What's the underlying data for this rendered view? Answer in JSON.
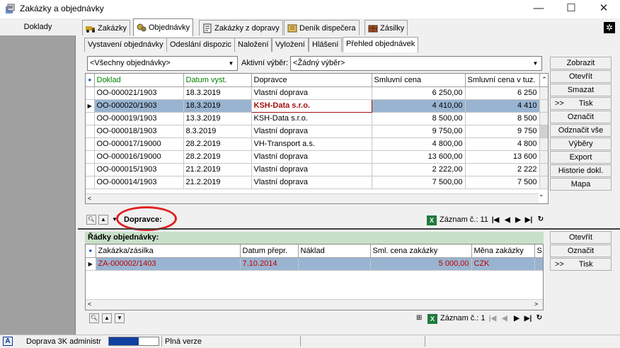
{
  "window": {
    "title": "Zakázky a objednávky",
    "minimize": "—",
    "maximize": "☐",
    "close": "✕"
  },
  "left": {
    "label": "Doklady"
  },
  "tabs": [
    {
      "label": "Zakázky",
      "icon": "truck-icon"
    },
    {
      "label": "Objednávky",
      "icon": "gears-icon"
    },
    {
      "label": "Zakázky z dopravy",
      "icon": "document-icon"
    },
    {
      "label": "Deník dispečera",
      "icon": "journal-icon"
    },
    {
      "label": "Zásilky",
      "icon": "package-icon"
    }
  ],
  "subtabs": [
    {
      "label": "Vystavení objednávky"
    },
    {
      "label": "Odeslání dispozic"
    },
    {
      "label": "Naložení"
    },
    {
      "label": "Vyložení"
    },
    {
      "label": "Hlášení"
    },
    {
      "label": "Přehled objednávek"
    }
  ],
  "filters": {
    "combo1": "<Všechny objednávky>",
    "active_label": "Aktivní výběr:",
    "combo2": "<Žádný výběr>"
  },
  "grid": {
    "headers": [
      "Doklad",
      "Datum vyst.",
      "Dopravce",
      "Smluvní cena",
      "Smluvní cena v tuz."
    ],
    "rows": [
      {
        "doklad": "OO-000021/1903",
        "datum": "18.3.2019",
        "dopravce": "Vlastní doprava",
        "cena": "6 250,00",
        "cena_tuz": "6 250"
      },
      {
        "doklad": "OO-000020/1903",
        "datum": "18.3.2019",
        "dopravce": "KSH-Data s.r.o.",
        "cena": "4 410,00",
        "cena_tuz": "4 410"
      },
      {
        "doklad": "OO-000019/1903",
        "datum": "13.3.2019",
        "dopravce": "KSH-Data s.r.o.",
        "cena": "8 500,00",
        "cena_tuz": "8 500"
      },
      {
        "doklad": "OO-000018/1903",
        "datum": "8.3.2019",
        "dopravce": "Vlastní doprava",
        "cena": "9 750,00",
        "cena_tuz": "9 750"
      },
      {
        "doklad": "OO-000017/19000",
        "datum": "28.2.2019",
        "dopravce": "VH-Transport a.s.",
        "cena": "4 800,00",
        "cena_tuz": "4 800"
      },
      {
        "doklad": "OO-000016/19000",
        "datum": "28.2.2019",
        "dopravce": "Vlastní doprava",
        "cena": "13 600,00",
        "cena_tuz": "13 600"
      },
      {
        "doklad": "OO-000015/1903",
        "datum": "21.2.2019",
        "dopravce": "Vlastní doprava",
        "cena": "2 222,00",
        "cena_tuz": "2 222"
      },
      {
        "doklad": "OO-000014/1903",
        "datum": "21.2.2019",
        "dopravce": "Vlastní doprava",
        "cena": "7 500,00",
        "cena_tuz": "7 500"
      }
    ],
    "selected_index": 1
  },
  "right_buttons": [
    "Zobrazit",
    "Otevřít",
    "Smazat",
    "Tisk",
    "Označit",
    "Odznačit vše",
    "Výběry",
    "Export",
    "Historie dokl.",
    "Mapa"
  ],
  "tisk_prefix": ">>",
  "nav1": {
    "field_label": "Dopravce:",
    "record_label": "Záznam č.: 11"
  },
  "lower": {
    "title": "Řádky objednávky:",
    "headers": [
      "Zakázka/zásilka",
      "Datum přepr.",
      "Náklad",
      "Sml. cena zakázky",
      "Měna zakázky",
      "S"
    ],
    "rows": [
      {
        "zakazka": "ZA-000002/1403",
        "datum": "7.10.2014",
        "naklad": "",
        "cena": "5 000,00",
        "mena": "CZK",
        "s": ""
      }
    ],
    "buttons": [
      "Otevřít",
      "Označit",
      "Tisk"
    ]
  },
  "nav2": {
    "record_label": "Záznam č.: 1"
  },
  "status": {
    "app_name": "Doprava 3K administr",
    "version": "Plná verze",
    "progress": 0.6
  }
}
